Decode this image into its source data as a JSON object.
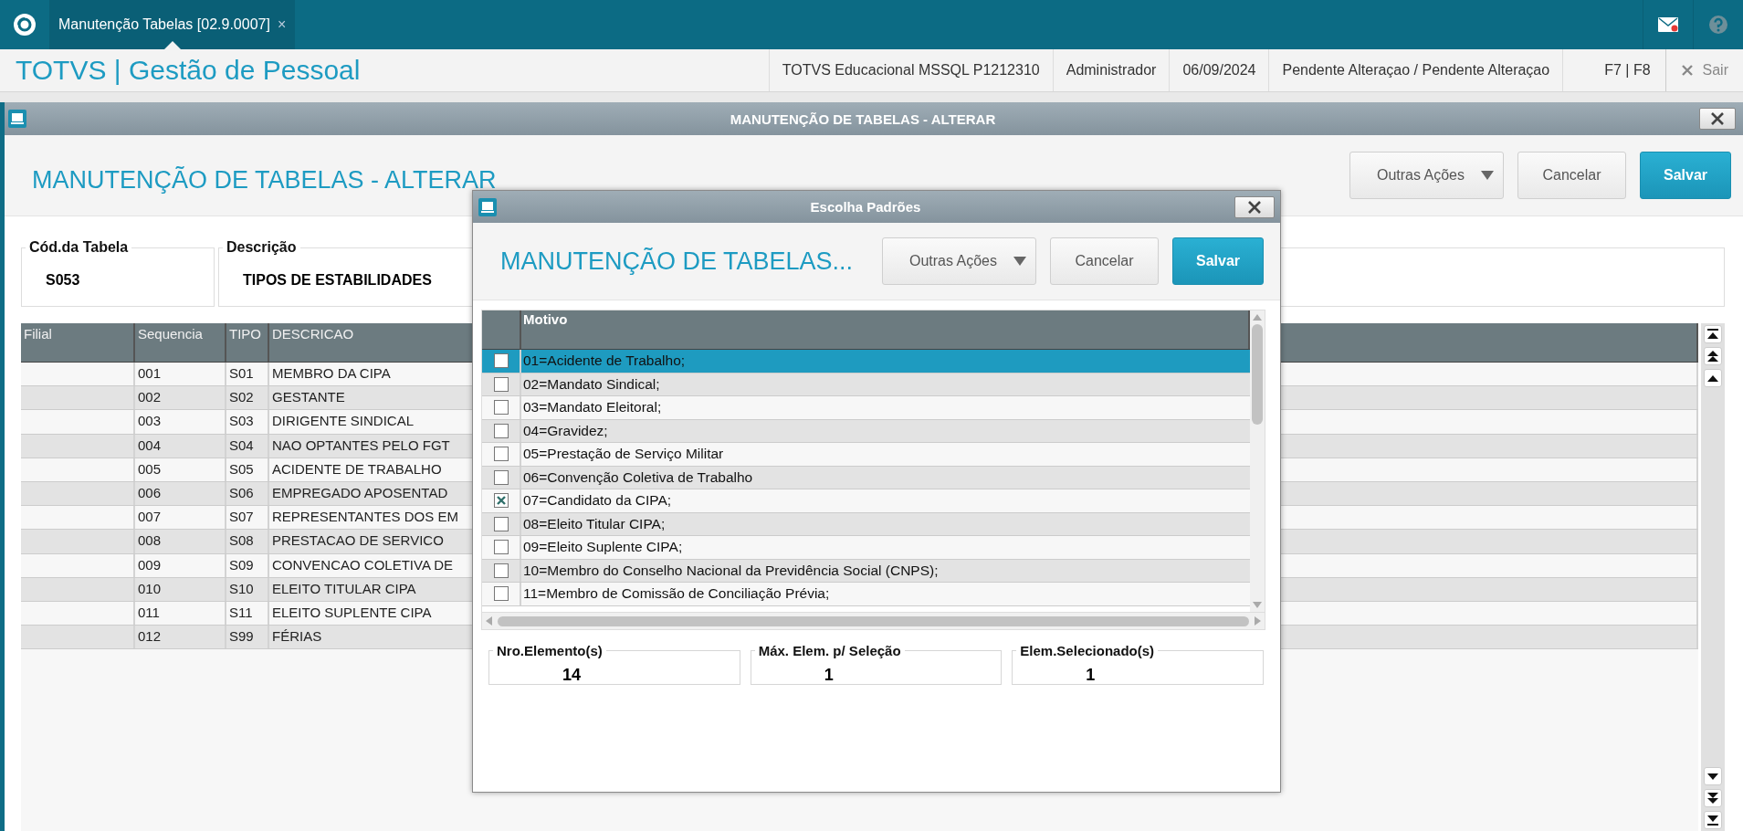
{
  "topbar": {
    "tab": {
      "label": "Manutenção Tabelas [02.9.0007]",
      "close": "×",
      "selected": true
    }
  },
  "header": {
    "title": "TOTVS | Gestão de Pessoal",
    "info": [
      "TOTVS Educacional MSSQL P1212310",
      "Administrador",
      "06/09/2024",
      "Pendente Alteraçao / Pendente Alteraçao",
      "F7 | F8"
    ],
    "exit": "Sair"
  },
  "window": {
    "title": "MANUTENÇÃO DE TABELAS - ALTERAR",
    "heading": "MANUTENÇÃO DE TABELAS - ALTERAR",
    "buttons": [
      {
        "label": "Outras Ações",
        "kind": "menu"
      },
      {
        "label": "Cancelar",
        "kind": "default"
      },
      {
        "label": "Salvar",
        "kind": "primary"
      }
    ],
    "fields": [
      {
        "label": "Cód.da Tabela",
        "value": "S053"
      },
      {
        "label": "Descrição",
        "value": "TIPOS DE ESTABILIDADES"
      }
    ],
    "table": {
      "columns": [
        "Filial",
        "Sequencia",
        "TIPO",
        "DESCRICAO"
      ],
      "rows": [
        {
          "sequencia": "001",
          "tipo": "S01",
          "descricao": "MEMBRO DA CIPA"
        },
        {
          "sequencia": "002",
          "tipo": "S02",
          "descricao": "GESTANTE"
        },
        {
          "sequencia": "003",
          "tipo": "S03",
          "descricao": "DIRIGENTE SINDICAL"
        },
        {
          "sequencia": "004",
          "tipo": "S04",
          "descricao": "NAO OPTANTES PELO FGT"
        },
        {
          "sequencia": "005",
          "tipo": "S05",
          "descricao": "ACIDENTE DE TRABALHO"
        },
        {
          "sequencia": "006",
          "tipo": "S06",
          "descricao": "EMPREGADO APOSENTAD"
        },
        {
          "sequencia": "007",
          "tipo": "S07",
          "descricao": "REPRESENTANTES DOS EM"
        },
        {
          "sequencia": "008",
          "tipo": "S08",
          "descricao": "PRESTACAO DE SERVICO"
        },
        {
          "sequencia": "009",
          "tipo": "S09",
          "descricao": "CONVENCAO COLETIVA DE"
        },
        {
          "sequencia": "010",
          "tipo": "S10",
          "descricao": "ELEITO TITULAR CIPA"
        },
        {
          "sequencia": "011",
          "tipo": "S11",
          "descricao": "ELEITO SUPLENTE CIPA"
        },
        {
          "sequencia": "012",
          "tipo": "S99",
          "descricao": "FÉRIAS"
        }
      ]
    }
  },
  "dialog": {
    "title": "Escolha Padrões",
    "heading": "MANUTENÇÃO DE TABELAS...",
    "buttons": [
      {
        "label": "Outras Ações",
        "kind": "menu"
      },
      {
        "label": "Cancelar",
        "kind": "default"
      },
      {
        "label": "Salvar",
        "kind": "primary"
      }
    ],
    "column": "Motivo",
    "rows": [
      {
        "label": "01=Acidente de Trabalho;",
        "checked": false,
        "selected": true
      },
      {
        "label": "02=Mandato Sindical;",
        "checked": false,
        "selected": false
      },
      {
        "label": "03=Mandato Eleitoral;",
        "checked": false,
        "selected": false
      },
      {
        "label": "04=Gravidez;",
        "checked": false,
        "selected": false
      },
      {
        "label": "05=Prestação de Serviço Militar",
        "checked": false,
        "selected": false
      },
      {
        "label": "06=Convenção Coletiva de Trabalho",
        "checked": false,
        "selected": false
      },
      {
        "label": "07=Candidato da CIPA;",
        "checked": true,
        "selected": false
      },
      {
        "label": "08=Eleito Titular CIPA;",
        "checked": false,
        "selected": false
      },
      {
        "label": "09=Eleito Suplente CIPA;",
        "checked": false,
        "selected": false
      },
      {
        "label": "10=Membro do Conselho Nacional da Previdência Social (CNPS);",
        "checked": false,
        "selected": false
      },
      {
        "label": "11=Membro de Comissão de Conciliação Prévia;",
        "checked": false,
        "selected": false
      }
    ],
    "counters": [
      {
        "label": "Nro.Elemento(s)",
        "value": "14"
      },
      {
        "label": "Máx. Elem. p/ Seleção",
        "value": "1"
      },
      {
        "label": "Elem.Selecionado(s)",
        "value": "1"
      }
    ]
  }
}
